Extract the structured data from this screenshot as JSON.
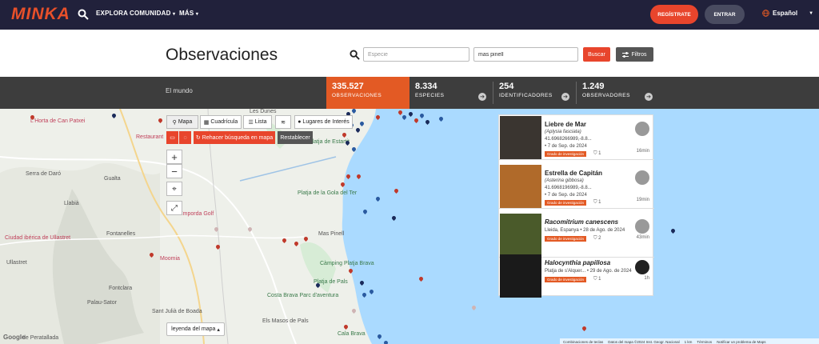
{
  "nav": {
    "logo": "MINKA",
    "links": [
      "EXPLORA",
      "COMUNIDAD",
      "MÁS"
    ],
    "register": "REGÍSTRATE",
    "login": "ENTRAR",
    "language": "Español"
  },
  "header": {
    "title": "Observaciones",
    "species_placeholder": "Especie",
    "place_value": "mas pinell",
    "search_button": "Buscar",
    "filters_button": "Filtros"
  },
  "stats": {
    "place": "El mundo",
    "items": [
      {
        "value": "335.527",
        "label": "OBSERVACIONES"
      },
      {
        "value": "8.334",
        "label": "ESPECIES"
      },
      {
        "value": "254",
        "label": "IDENTIFICADORES"
      },
      {
        "value": "1.249",
        "label": "OBSERVADORES"
      }
    ]
  },
  "map_controls": {
    "views": [
      "Mapa",
      "Cuadrícula",
      "Lista"
    ],
    "places_of_interest": "Lugares de Interés",
    "redo_search": "Rehacer búsqueda en mapa",
    "reset": "Restablecer",
    "legend": "leyenda del mapa",
    "google": "Google"
  },
  "map_labels": [
    "L'Horta de Can Patxei",
    "Restaurant",
    "Serra de Daró",
    "Gualta",
    "Llabià",
    "Fontanelles",
    "Ciudad ibérica de Ullastret",
    "Ullastret",
    "Fontclara",
    "Palau-Sator",
    "Sant Julià de Boada",
    "Els Masos de Pals",
    "Les Dunes",
    "Platja de Estartit",
    "Platja de la Gola del Ter",
    "Emporda Golf",
    "Mas Pinell",
    "Moomia",
    "Càmping Platja Brava",
    "Platja de Pals",
    "Costa Brava Parc d'aventura",
    "Platja de Pals",
    "Cala Brava",
    "de Peratallada"
  ],
  "map_footer": [
    "Combinaciones de teclas",
    "Datos del mapa ©2024 Inst. Geogr. Nacional",
    "1 km",
    "Términos",
    "Notificar un problema de Maps"
  ],
  "results": [
    {
      "title": "Liebre de Mar",
      "sci": "Aplysia fasciata",
      "coords": "41.6968266989,-8.8...",
      "date": "• 7 de Sep. de 2024",
      "badge": "Grado de investigación",
      "ids": "1",
      "time": "16min",
      "img": "#3a3530"
    },
    {
      "title": "Estrella de Capitán",
      "sci": "Asterina gibbosa",
      "coords": "41.6968196989,-8.8...",
      "date": "• 7 de Sep. de 2024",
      "badge": "Grado de investigación",
      "ids": "1",
      "time": "19min",
      "img": "#b06a2a"
    },
    {
      "title": "Racomitrium canescens",
      "sci": "",
      "coords": "Lleida, Espanya • 28 de Ago. de 2024",
      "date": "",
      "badge": "Grado de investigación",
      "ids": "2",
      "time": "43min",
      "img": "#4a5a2a"
    },
    {
      "title": "Halocynthia papillosa",
      "sci": "",
      "coords": "Platja de s'Alquer... • 29 de Ago. de 2024",
      "date": "",
      "badge": "Grado de investigación",
      "ids": "1",
      "time": "1h",
      "img": "#1a1a1a"
    }
  ],
  "colors": {
    "nav_bg": "#21213b",
    "accent": "#e35a24",
    "stats_bg": "#3d3d3d",
    "sea": "#aadaff"
  }
}
